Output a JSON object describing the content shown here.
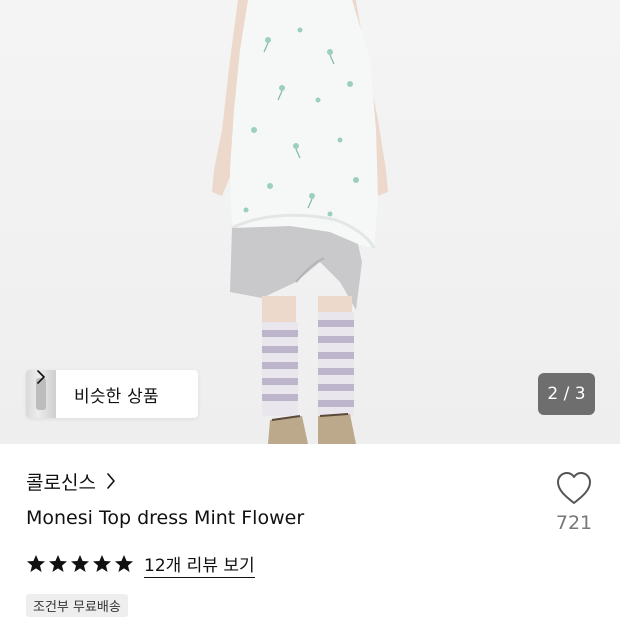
{
  "hero": {
    "similar_products_label": "비슷한 상품",
    "page_counter": "2 / 3"
  },
  "product": {
    "brand": "콜로신스",
    "title": "Monesi Top dress Mint Flower",
    "wishlist_count": "721",
    "rating": 5,
    "review_link": "12개 리뷰 보기",
    "shipping_badge": "조건부 무료배송"
  },
  "colors": {
    "text": "#111111",
    "muted": "#777777",
    "badge_bg": "#eeeeee",
    "counter_bg": "#3c3c3c"
  },
  "icons": {
    "similar": "chevron-right-icon",
    "brand": "chevron-right-icon",
    "wishlist": "heart-outline-icon",
    "rating": "star-filled-icon"
  }
}
